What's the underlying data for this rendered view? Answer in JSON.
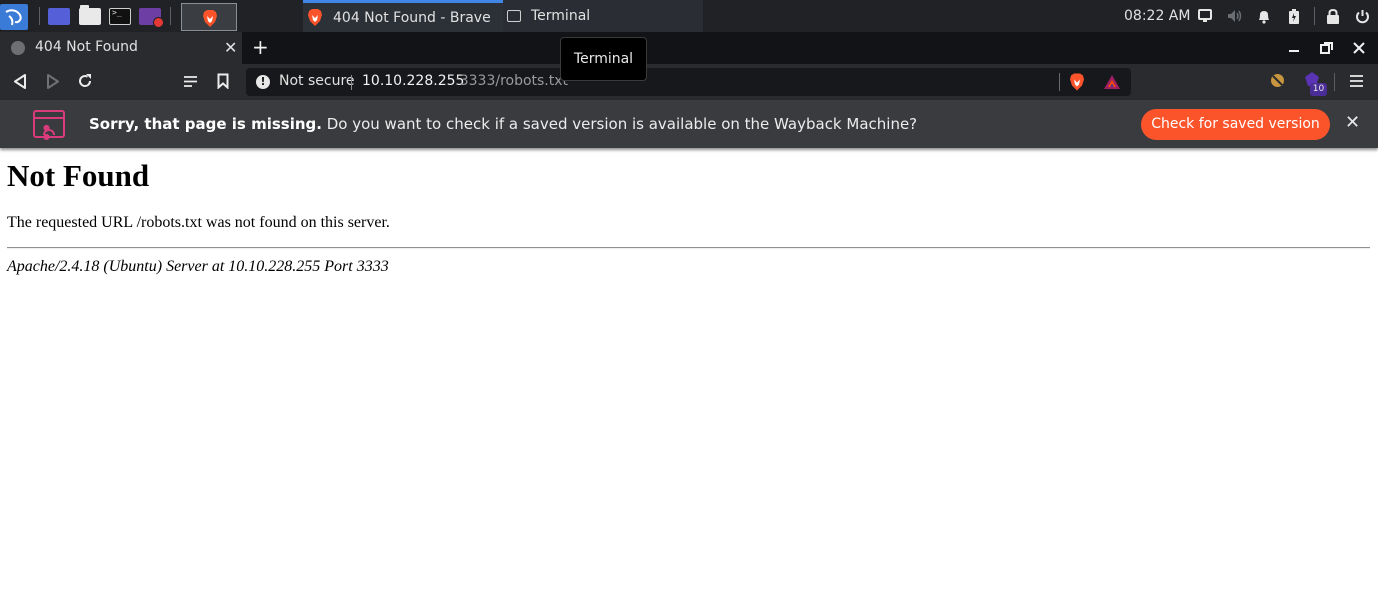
{
  "taskbar": {
    "tasks": [
      {
        "label": "404 Not Found - Brave"
      },
      {
        "label": "Terminal"
      }
    ],
    "clock": "08:22 AM"
  },
  "browser": {
    "tab": {
      "title": "404 Not Found"
    },
    "tooltip": "Terminal",
    "address": {
      "security_label": "Not secure",
      "host": "10.10.228.255",
      "path": ":3333/robots.txt"
    },
    "extension_badge": "10"
  },
  "infobar": {
    "bold_text": "Sorry, that page is missing.",
    "text": " Do you want to check if a saved version is available on the Wayback Machine?",
    "button_label": "Check for saved version"
  },
  "page": {
    "heading": "Not Found",
    "message": "The requested URL /robots.txt was not found on this server.",
    "signature": "Apache/2.4.18 (Ubuntu) Server at 10.10.228.255 Port 3333"
  },
  "colors": {
    "panel_bg": "#202226",
    "tab_active_bg": "#2a2b2e",
    "brave_orange": "#fb542b",
    "task_indicator": "#3f86e6",
    "infobar_icon": "#d93b7c"
  }
}
